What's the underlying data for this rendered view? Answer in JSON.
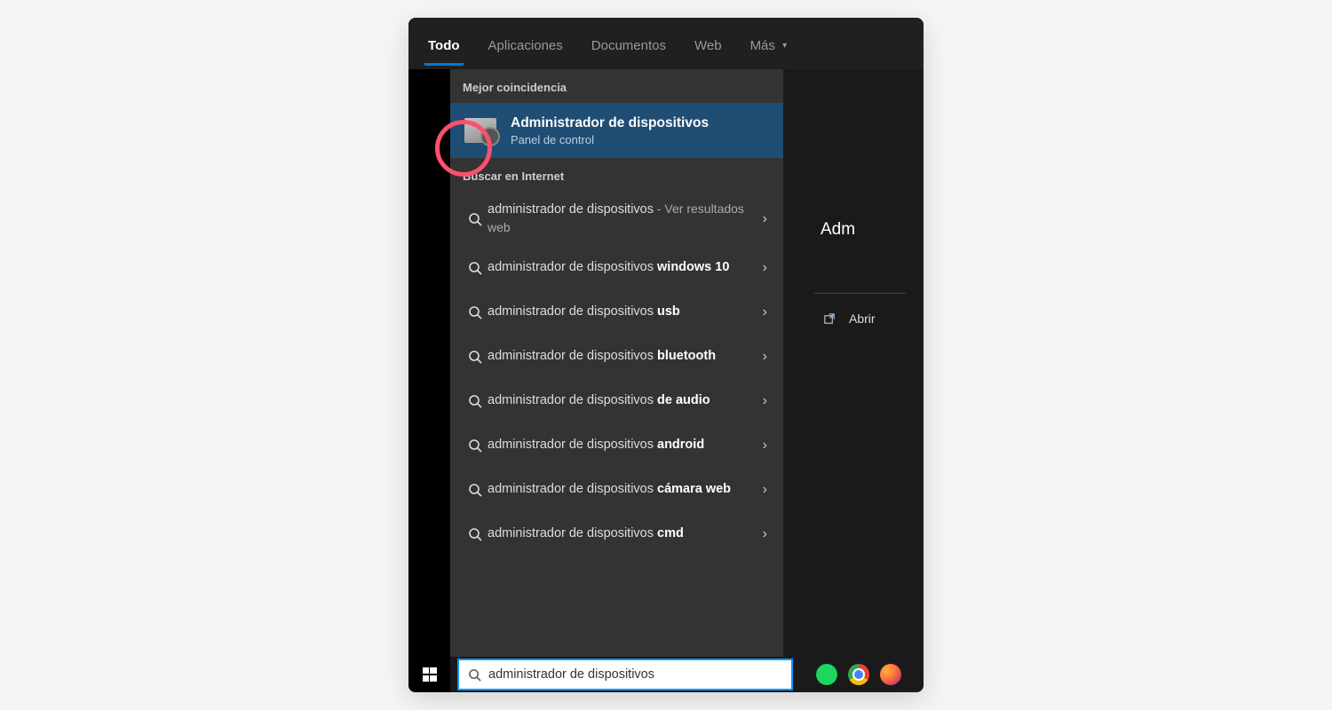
{
  "tabs": {
    "all": "Todo",
    "apps": "Aplicaciones",
    "docs": "Documentos",
    "web": "Web",
    "more": "Más"
  },
  "sections": {
    "best_match": "Mejor coincidencia",
    "search_web": "Buscar en Internet"
  },
  "best_match": {
    "title": "Administrador de dispositivos",
    "subtitle": "Panel de control"
  },
  "suggestions": [
    {
      "light": "administrador de dispositivos",
      "dim": " - Ver resultados web"
    },
    {
      "light": "administrador de dispositivos ",
      "bold": "windows 10"
    },
    {
      "light": "administrador de dispositivos ",
      "bold": "usb"
    },
    {
      "light": "administrador de dispositivos ",
      "bold": "bluetooth"
    },
    {
      "light": "administrador de dispositivos ",
      "bold": "de audio"
    },
    {
      "light": "administrador de dispositivos ",
      "bold": "android"
    },
    {
      "light": "administrador de dispositivos ",
      "bold": "cámara web"
    },
    {
      "light": "administrador de dispositivos ",
      "bold": "cmd"
    }
  ],
  "preview": {
    "title": "Adm",
    "open": "Abrir"
  },
  "search": {
    "value": "administrador de dispositivos"
  }
}
